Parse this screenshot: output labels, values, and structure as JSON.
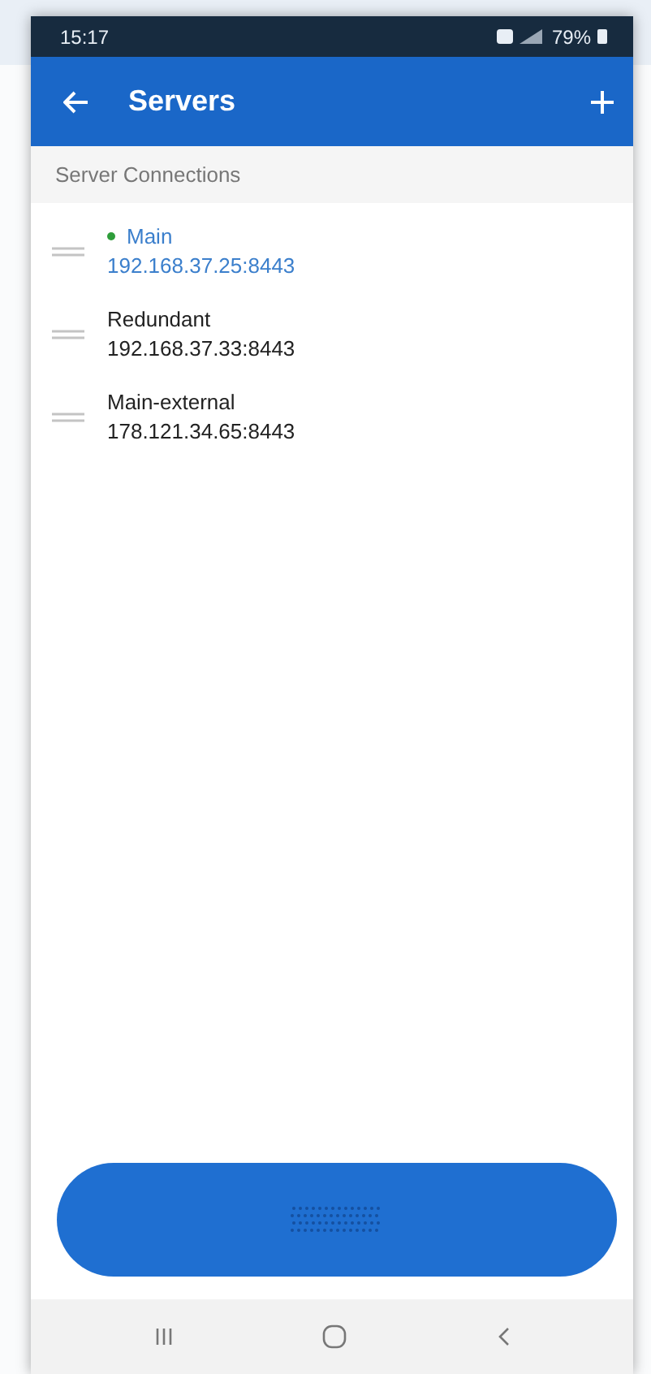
{
  "status_bar": {
    "time": "15:17",
    "battery": "79%"
  },
  "app_bar": {
    "title": "Servers"
  },
  "section_header": "Server Connections",
  "servers": [
    {
      "name": "Main",
      "address": "192.168.37.25:8443",
      "active": true
    },
    {
      "name": "Redundant",
      "address": "192.168.37.33:8443",
      "active": false
    },
    {
      "name": "Main-external",
      "address": "178.121.34.65:8443",
      "active": false
    }
  ]
}
